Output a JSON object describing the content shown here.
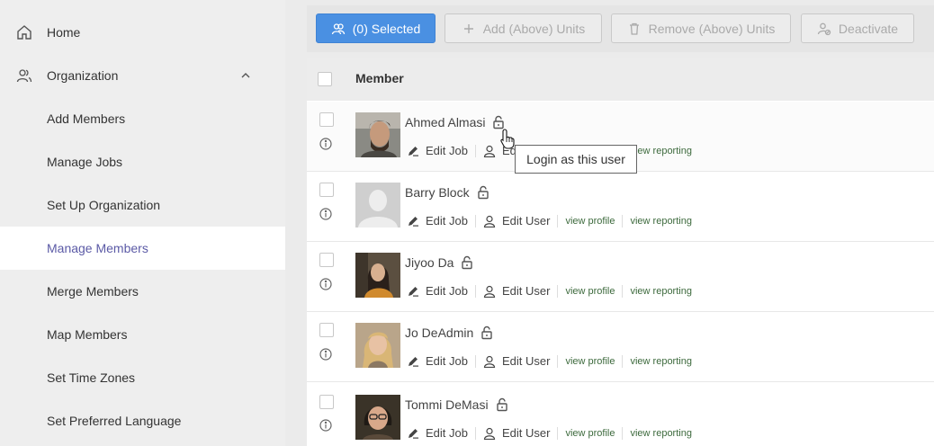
{
  "sidebar": {
    "items": [
      {
        "label": "Home",
        "icon": "home-icon"
      },
      {
        "label": "Organization",
        "icon": "people-icon"
      },
      {
        "label": "Add Members"
      },
      {
        "label": "Manage Jobs"
      },
      {
        "label": "Set Up Organization"
      },
      {
        "label": "Manage Members"
      },
      {
        "label": "Merge Members"
      },
      {
        "label": "Map Members"
      },
      {
        "label": "Set Time Zones"
      },
      {
        "label": "Set Preferred Language"
      }
    ]
  },
  "toolbar": {
    "selected_label": "(0) Selected",
    "add_label": "Add (Above) Units",
    "remove_label": "Remove (Above) Units",
    "deactivate_label": "Deactivate"
  },
  "table": {
    "header": "Member",
    "actions": {
      "edit_job": "Edit Job",
      "edit_user": "Edit User",
      "view_profile": "view profile",
      "view_reporting": "view reporting"
    },
    "rows": [
      {
        "name": "Ahmed Almasi"
      },
      {
        "name": "Barry Block"
      },
      {
        "name": "Jiyoo Da"
      },
      {
        "name": "Jo DeAdmin"
      },
      {
        "name": "Tommi DeMasi"
      }
    ]
  },
  "tooltip": {
    "text": "Login as this user"
  },
  "colors": {
    "primary": "#4a90e2",
    "active_nav": "#5b5aa6",
    "link": "#3d6a3d"
  }
}
